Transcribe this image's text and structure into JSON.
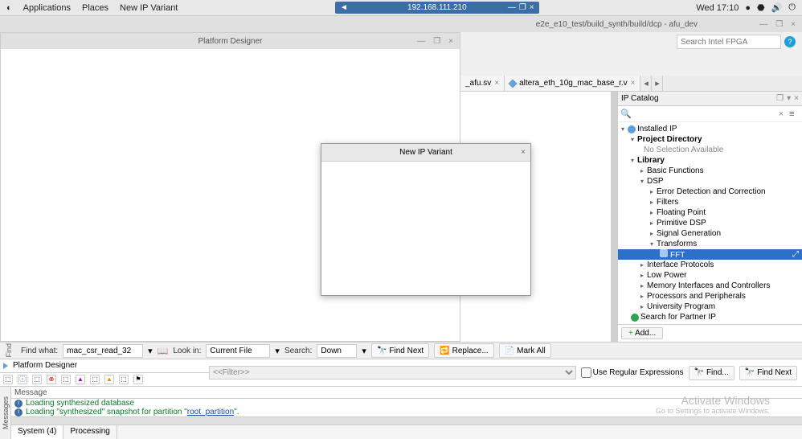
{
  "topbar": {
    "apps": "Applications",
    "places": "Places",
    "running": "New IP Variant",
    "taskbar_ip": "192.168.111.210",
    "clock": "Wed 17:10"
  },
  "quartus": {
    "title_right": "e2e_e10_test/build_synth/build/dcp - afu_dev",
    "search_placeholder": "Search Intel FPGA"
  },
  "pd": {
    "title": "Platform Designer"
  },
  "tabs": {
    "tab1_label": "_afu.sv",
    "tab2_label": "altera_eth_10g_mac_base_r.v"
  },
  "ip": {
    "panel_title": "IP Catalog",
    "installed": "Installed IP",
    "project_dir": "Project Directory",
    "no_sel": "No Selection Available",
    "library": "Library",
    "basic": "Basic Functions",
    "dsp": "DSP",
    "edc": "Error Detection and Correction",
    "filters": "Filters",
    "fp": "Floating Point",
    "pdsp": "Primitive DSP",
    "siggen": "Signal Generation",
    "trans": "Transforms",
    "fft": "FFT",
    "ifproto": "Interface Protocols",
    "lowpower": "Low Power",
    "memif": "Memory Interfaces and Controllers",
    "procper": "Processors and Peripherals",
    "uniprog": "University Program",
    "search_partner": "Search for Partner IP",
    "add_btn": "Add..."
  },
  "find": {
    "rot_label": "Find",
    "find_what": "Find what:",
    "find_what_val": "mac_csr_read_32",
    "look_in": "Look in:",
    "look_in_val": "Current File",
    "search_lbl": "Search:",
    "search_val": "Down",
    "find_next": "Find Next",
    "replace": "Replace...",
    "mark_all": "Mark All"
  },
  "pd_bottom": {
    "tab_label": "Platform Designer",
    "filter_placeholder": "<<Filter>>",
    "regex_label": "Use Regular Expressions",
    "find_btn": "Find...",
    "find_next": "Find Next"
  },
  "msg": {
    "rot_label": "Messages",
    "header": "Message",
    "line1": "Loading synthesized database",
    "line2a": "Loading \"synthesized\" snapshot for partition \"",
    "line2b": "root_partition",
    "line2c": "\".",
    "tab_system": "System (4)",
    "tab_processing": "Processing"
  },
  "watermark": {
    "main": "Activate Windows",
    "sub": "Go to Settings to activate Windows."
  },
  "dialog": {
    "title": "New IP Variant"
  }
}
